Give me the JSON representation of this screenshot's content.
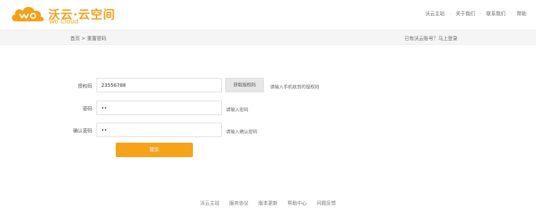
{
  "brand": {
    "title": "沃云·云空间",
    "subtitle": "Wo Cloud",
    "color": "#f5a01a"
  },
  "topnav": {
    "items": [
      "沃云主站",
      "关于我们",
      "联系我们",
      "帮助"
    ],
    "separator": "·"
  },
  "breadcrumb": {
    "home": "首页",
    "separator": ">",
    "current": "重置密码"
  },
  "login_hint": "已有沃云账号？马上登录",
  "form": {
    "auth_code": {
      "label": "授权码",
      "value": "23556788",
      "button": "获取授权码",
      "hint": "请输入手机收到的授权码"
    },
    "password": {
      "label": "密码",
      "value": "••",
      "hint": "请输入密码"
    },
    "confirm_password": {
      "label": "确认密码",
      "value": "••",
      "hint": "请输入确认密码"
    },
    "submit": "提交",
    "accent": "#f7a21b"
  },
  "footer": {
    "links": [
      "沃云主站",
      "服务协议",
      "版本更新",
      "帮助中心",
      "问题反馈"
    ]
  }
}
